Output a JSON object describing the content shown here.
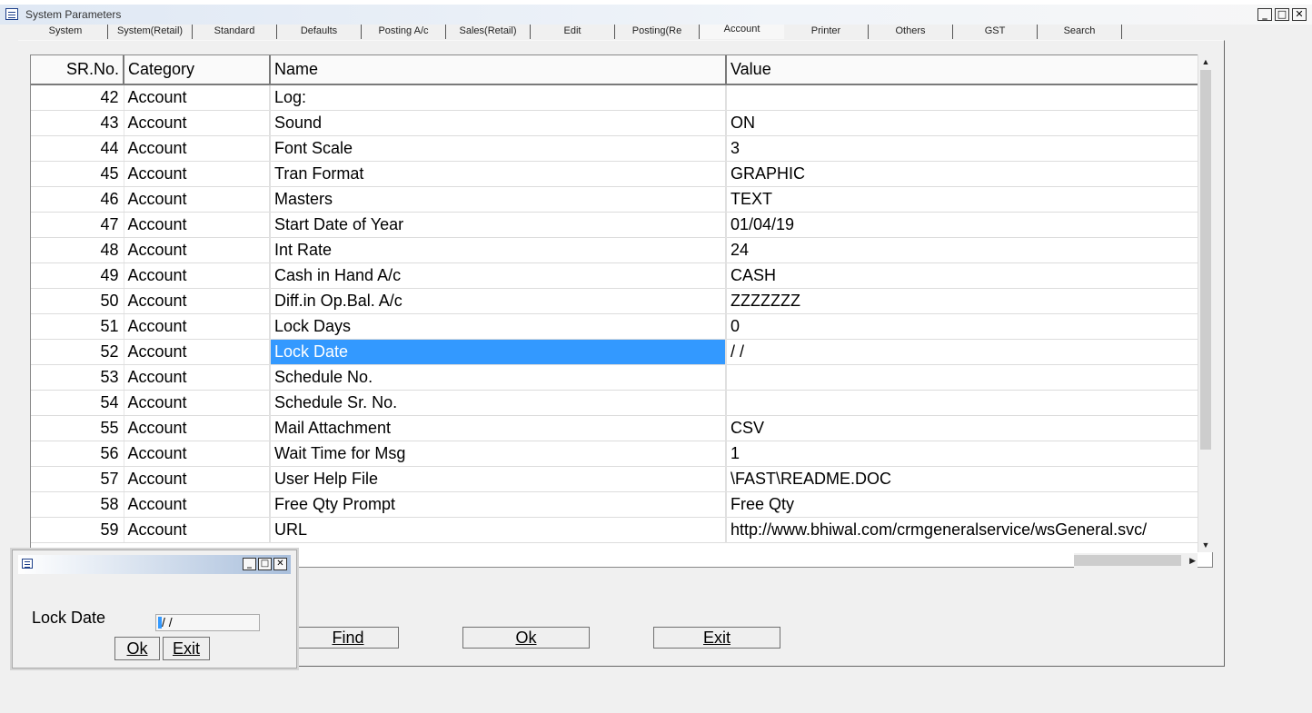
{
  "window": {
    "title": "System Parameters",
    "min_symbol": "_",
    "max_symbol": "□",
    "close_symbol": "✕"
  },
  "tabs": [
    {
      "label": "System"
    },
    {
      "label": "System(Retail)"
    },
    {
      "label": "Standard"
    },
    {
      "label": "Defaults"
    },
    {
      "label": "Posting A/c"
    },
    {
      "label": "Sales(Retail)"
    },
    {
      "label": "Edit"
    },
    {
      "label": "Posting(Re"
    },
    {
      "label": "Account",
      "active": true
    },
    {
      "label": "Printer"
    },
    {
      "label": "Others"
    },
    {
      "label": "GST"
    },
    {
      "label": "Search"
    }
  ],
  "grid": {
    "headers": {
      "sr": "SR.No.",
      "category": "Category",
      "name": "Name",
      "value": "Value"
    },
    "selected_row": 10,
    "rows": [
      {
        "sr": "42",
        "category": "Account",
        "name": "Log:",
        "value": ""
      },
      {
        "sr": "43",
        "category": "Account",
        "name": "Sound",
        "value": "ON"
      },
      {
        "sr": "44",
        "category": "Account",
        "name": "Font Scale",
        "value": "3"
      },
      {
        "sr": "45",
        "category": "Account",
        "name": "Tran Format",
        "value": "GRAPHIC"
      },
      {
        "sr": "46",
        "category": "Account",
        "name": "Masters",
        "value": "TEXT"
      },
      {
        "sr": "47",
        "category": "Account",
        "name": "Start Date of Year",
        "value": "01/04/19"
      },
      {
        "sr": "48",
        "category": "Account",
        "name": "Int Rate",
        "value": "24"
      },
      {
        "sr": "49",
        "category": "Account",
        "name": "Cash in Hand A/c",
        "value": "CASH"
      },
      {
        "sr": "50",
        "category": "Account",
        "name": "Diff.in Op.Bal. A/c",
        "value": "ZZZZZZZ"
      },
      {
        "sr": "51",
        "category": "Account",
        "name": "Lock Days",
        "value": "0"
      },
      {
        "sr": "52",
        "category": "Account",
        "name": "Lock Date",
        "value": " /  /"
      },
      {
        "sr": "53",
        "category": "Account",
        "name": "Schedule No.",
        "value": ""
      },
      {
        "sr": "54",
        "category": "Account",
        "name": "Schedule Sr. No.",
        "value": ""
      },
      {
        "sr": "55",
        "category": "Account",
        "name": "Mail Attachment",
        "value": "CSV"
      },
      {
        "sr": "56",
        "category": "Account",
        "name": "Wait Time for Msg",
        "value": "1"
      },
      {
        "sr": "57",
        "category": "Account",
        "name": "User Help File",
        "value": "\\FAST\\README.DOC"
      },
      {
        "sr": "58",
        "category": "Account",
        "name": "Free Qty Prompt",
        "value": "Free Qty"
      },
      {
        "sr": "59",
        "category": "Account",
        "name": "URL",
        "value": "http://www.bhiwal.com/crmgeneralservice/wsGeneral.svc/"
      }
    ]
  },
  "buttons": {
    "find": "Find",
    "ok": "Ok",
    "exit": "Exit"
  },
  "dialog": {
    "label": "Lock Date",
    "input_value": "/  /",
    "ok": "Ok",
    "exit": "Exit"
  },
  "colors": {
    "selection": "#3399ff"
  }
}
